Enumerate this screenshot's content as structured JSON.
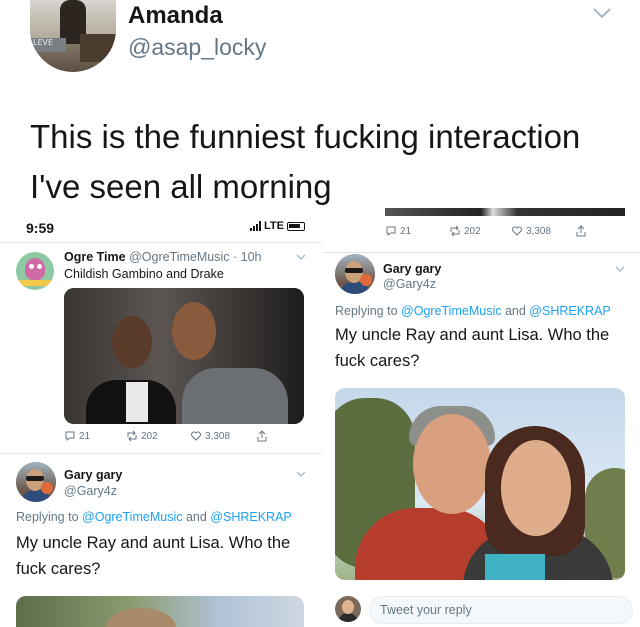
{
  "outer_tweet": {
    "name": "Amanda",
    "handle": "@asap_locky",
    "avatar_sign_text": "LEVE",
    "text": "This is the funniest fucking interaction I've seen all morning"
  },
  "left_screenshot": {
    "status_bar": {
      "time": "9:59",
      "network": "LTE"
    },
    "tweet": {
      "name": "Ogre Time",
      "handle_time": "@OgreTimeMusic · 10h",
      "text": "Childish Gambino and Drake",
      "actions": {
        "replies": "21",
        "retweets": "202",
        "likes": "3,308"
      }
    },
    "reply": {
      "name": "Gary gary",
      "handle": "@Gary4z",
      "replying_prefix": "Replying to",
      "replying_user1": "@OgreTimeMusic",
      "replying_and": "and",
      "replying_user2": "@SHREKRAP",
      "text": "My uncle Ray and aunt Lisa. Who the fuck cares?"
    }
  },
  "right_screenshot": {
    "actions": {
      "replies": "21",
      "retweets": "202",
      "likes": "3,308"
    },
    "reply": {
      "name": "Gary gary",
      "handle": "@Gary4z",
      "replying_prefix": "Replying to",
      "replying_user1": "@OgreTimeMusic",
      "replying_and": "and",
      "replying_user2": "@SHREKRAP",
      "text": "My uncle Ray and aunt Lisa. Who the fuck cares?"
    },
    "reply_bar": {
      "placeholder": "Tweet your reply"
    }
  },
  "colors": {
    "link": "#1da1f2",
    "secondary_text": "#657786",
    "divider": "#e1e8ed"
  }
}
